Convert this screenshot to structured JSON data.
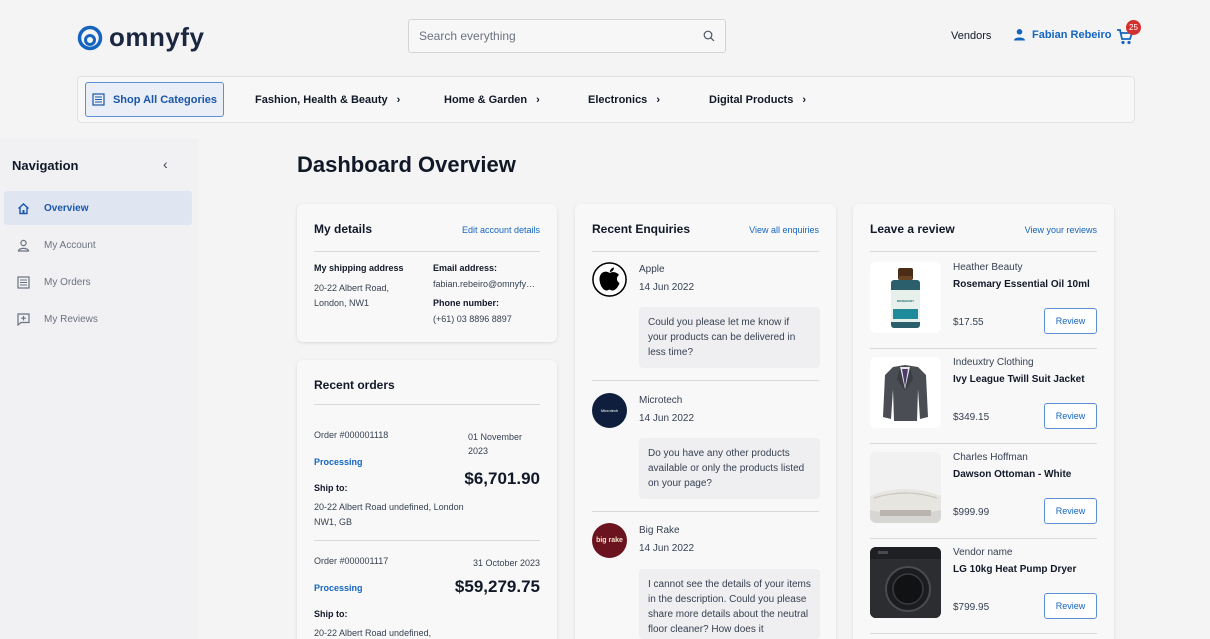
{
  "header": {
    "logo_text": "omnyfy",
    "search_placeholder": "Search everything",
    "vendors_label": "Vendors",
    "user_name": "Fabian Rebeiro",
    "cart_count": "25"
  },
  "categories": {
    "shop_all": "Shop All Categories",
    "items": [
      "Fashion, Health & Beauty",
      "Home & Garden",
      "Electronics",
      "Digital Products"
    ]
  },
  "sidebar": {
    "title": "Navigation",
    "items": [
      {
        "label": "Overview",
        "icon": "home-icon",
        "active": true
      },
      {
        "label": "My Account",
        "icon": "person-icon"
      },
      {
        "label": "My Orders",
        "icon": "list-icon"
      },
      {
        "label": "My Reviews",
        "icon": "review-icon"
      }
    ]
  },
  "page": {
    "title": "Dashboard Overview"
  },
  "my_details": {
    "title": "My details",
    "link": "Edit account details",
    "shipping_label": "My shipping address",
    "shipping_address": [
      "20-22 Albert Road,",
      "London, NW1"
    ],
    "email_label": "Email address:",
    "email": "fabian.rebeiro@omnyfy…",
    "phone_label": "Phone number:",
    "phone": "(+61) 03 8896 8897"
  },
  "recent_orders": {
    "title": "Recent orders",
    "orders": [
      {
        "number": "Order #000001118",
        "date": "01 November 2023",
        "status": "Processing",
        "amount": "$6,701.90",
        "ship_label": "Ship to:",
        "address": "20-22 Albert Road undefined, London NW1, GB"
      },
      {
        "number": "Order #000001117",
        "date": "31 October 2023",
        "status": "Processing",
        "amount": "$59,279.75",
        "ship_label": "Ship to:",
        "address": "20-22 Albert Road undefined,"
      }
    ]
  },
  "enquiries": {
    "title": "Recent Enquiries",
    "link": "View all enquiries",
    "items": [
      {
        "name": "Apple",
        "date": "14 Jun 2022",
        "message": "Could you please let me know if your products can be delivered in less time?"
      },
      {
        "name": "Microtech",
        "date": "14 Jun 2022",
        "avatar_text": "Microtech",
        "message": "Do you have any other products available or only the products listed on your page?"
      },
      {
        "name": "Big Rake",
        "date": "14 Jun 2022",
        "avatar_text": "big rake",
        "message": "I cannot see the details of your items in the description. Could you please share more details about the neutral floor cleaner? How does it"
      }
    ]
  },
  "reviews": {
    "title": "Leave a review",
    "link": "View your reviews",
    "button_label": "Review",
    "items": [
      {
        "vendor": "Heather Beauty",
        "name": "Rosemary Essential Oil 10ml",
        "price": "$17.55",
        "image_text": "ROSEMARY"
      },
      {
        "vendor": "Indeuxtry Clothing",
        "name": "Ivy League Twill Suit Jacket",
        "price": "$349.15"
      },
      {
        "vendor": "Charles Hoffman",
        "name": "Dawson Ottoman - White",
        "price": "$999.99"
      },
      {
        "vendor": "Vendor name",
        "name": "LG 10kg Heat Pump Dryer",
        "price": "$799.95"
      }
    ]
  },
  "colors": {
    "accent": "#1565c0",
    "badge": "#d32f2f",
    "active_nav_bg": "#dfe6f1"
  }
}
